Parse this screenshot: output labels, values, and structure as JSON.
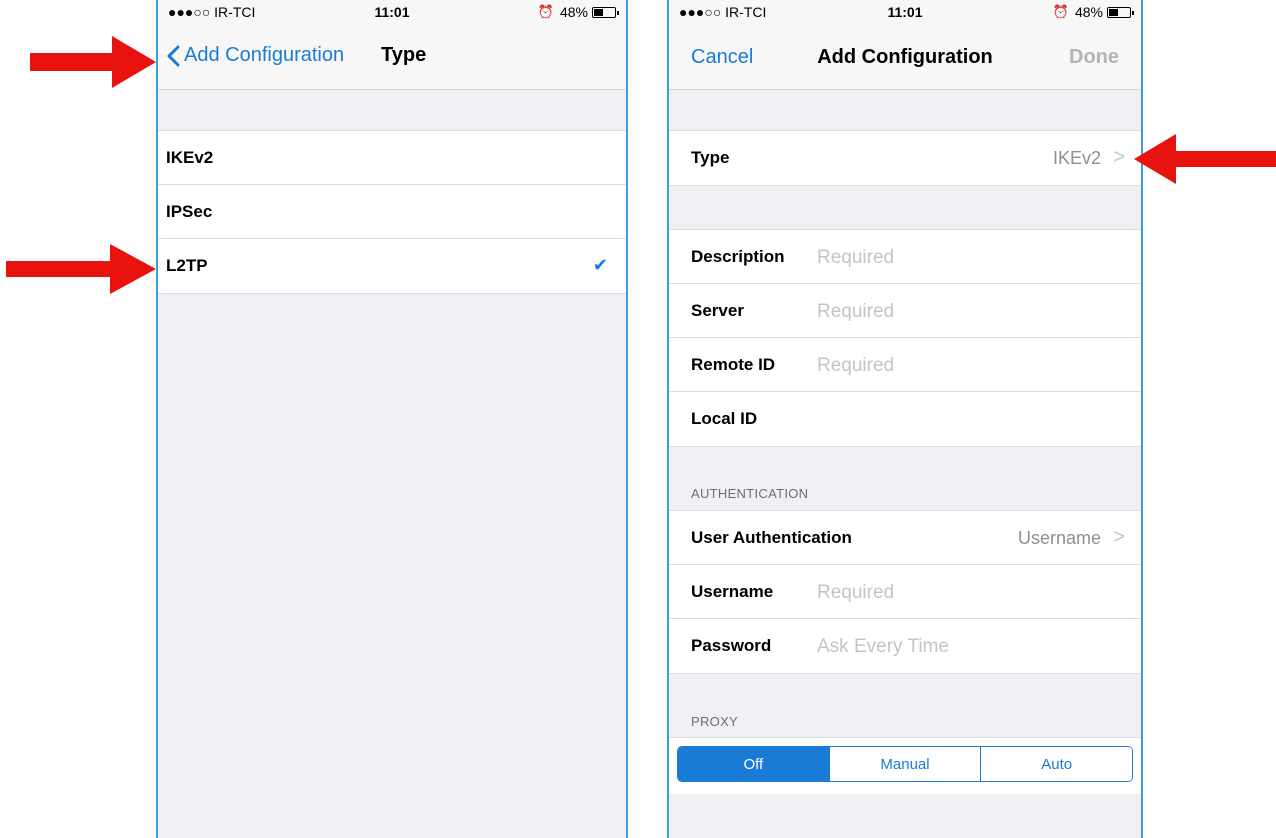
{
  "colors": {
    "accent": "#1a7bd6",
    "arrow": "#e8130f",
    "frame": "#3aa0dc"
  },
  "left_screen": {
    "status": {
      "carrier": "●●●○○ IR-TCI",
      "time": "11:01",
      "battery": "48%",
      "battery_level": 0.48
    },
    "nav": {
      "back_label": "Add Configuration",
      "title": "Type"
    },
    "options": [
      {
        "label": "IKEv2",
        "checked": false
      },
      {
        "label": "IPSec",
        "checked": false
      },
      {
        "label": "L2TP",
        "checked": true
      }
    ],
    "check_glyph": "✔"
  },
  "right_screen": {
    "status": {
      "carrier": "●●●○○ IR-TCI",
      "time": "11:01",
      "battery": "48%",
      "battery_level": 0.48
    },
    "nav": {
      "cancel": "Cancel",
      "title": "Add Configuration",
      "done": "Done"
    },
    "type_row": {
      "label": "Type",
      "value": "IKEv2"
    },
    "fields": [
      {
        "label": "Description",
        "placeholder": "Required"
      },
      {
        "label": "Server",
        "placeholder": "Required"
      },
      {
        "label": "Remote ID",
        "placeholder": "Required"
      },
      {
        "label": "Local ID",
        "placeholder": ""
      }
    ],
    "auth_header": "AUTHENTICATION",
    "user_auth": {
      "label": "User Authentication",
      "value": "Username"
    },
    "auth_fields": [
      {
        "label": "Username",
        "placeholder": "Required"
      },
      {
        "label": "Password",
        "placeholder": "Ask Every Time"
      }
    ],
    "proxy_header": "PROXY",
    "proxy_options": [
      "Off",
      "Manual",
      "Auto"
    ],
    "proxy_selected": "Off"
  }
}
